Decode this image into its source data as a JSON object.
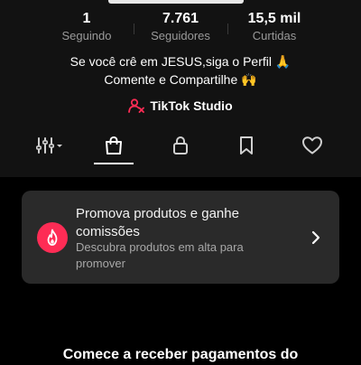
{
  "profile": {
    "stats": [
      {
        "value": "1",
        "label": "Seguindo"
      },
      {
        "value": "7.761",
        "label": "Seguidores"
      },
      {
        "value": "15,5 mil",
        "label": "Curtidas"
      }
    ],
    "bio_line1": "Se você crê em JESUS,siga o Perfil 🙏",
    "bio_line2": "Comente e Compartilhe 🙌",
    "studio_label": "TikTok Studio"
  },
  "tabs": [
    {
      "icon": "filter-bars-icon"
    },
    {
      "icon": "shopping-bag-icon",
      "active": true
    },
    {
      "icon": "lock-icon"
    },
    {
      "icon": "bookmark-icon"
    },
    {
      "icon": "heart-icon"
    }
  ],
  "promo_card": {
    "icon": "flame-icon",
    "title": "Promova produtos e ganhe comissões",
    "subtitle": "Descubra produtos em alta para promover",
    "accent_color": "#fe2c55"
  },
  "bottom_text": "Comece a receber pagamentos do"
}
